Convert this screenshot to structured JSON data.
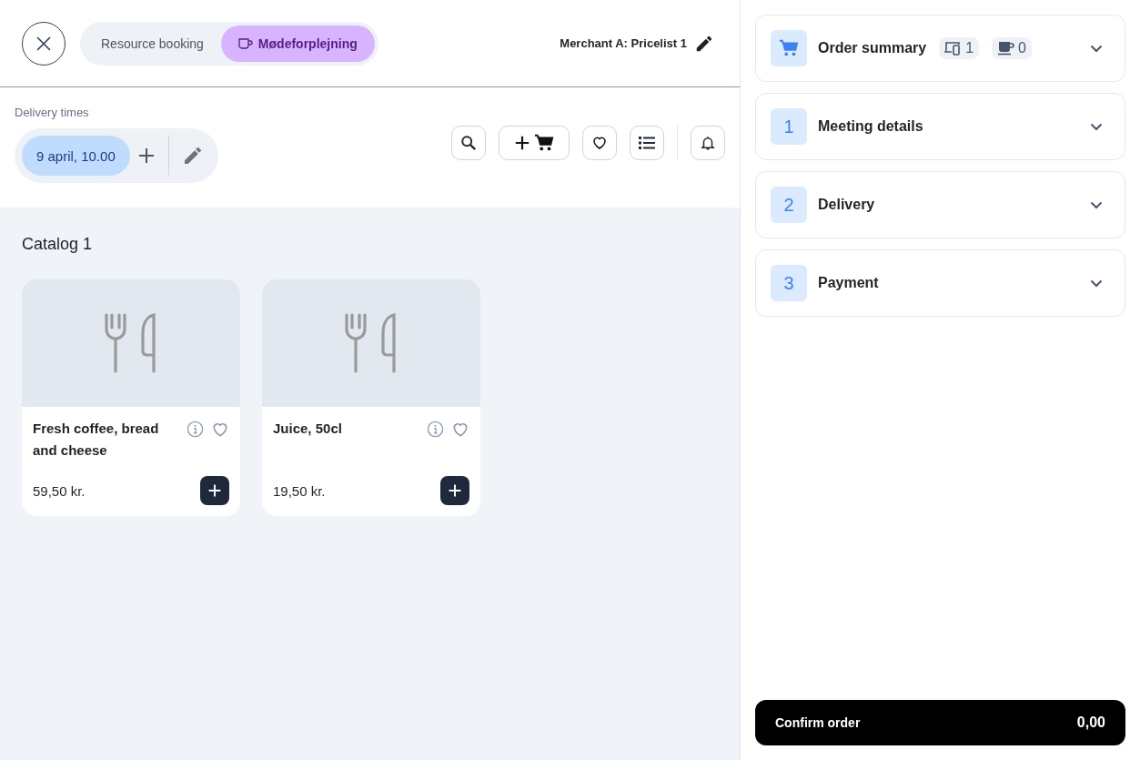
{
  "header": {
    "tabs": [
      {
        "label": "Resource booking",
        "kind": "resource",
        "selected": false
      },
      {
        "label": "Mødeforplejning",
        "kind": "catering",
        "selected": true
      }
    ],
    "pricelist": "Merchant A: Pricelist 1"
  },
  "delivery": {
    "label": "Delivery times",
    "times": [
      "9 april, 10.00"
    ]
  },
  "catalog": {
    "title": "Catalog 1",
    "products": [
      {
        "name": "Fresh coffee, bread and cheese",
        "price": "59,50 kr."
      },
      {
        "name": "Juice, 50cl",
        "price": "19,50 kr."
      }
    ]
  },
  "steps": [
    {
      "kind": "summary",
      "title": "Order summary",
      "badges": [
        {
          "kind": "devices",
          "count": "1"
        },
        {
          "kind": "catering",
          "count": "0"
        }
      ]
    },
    {
      "kind": "step",
      "number": "1",
      "title": "Meeting details"
    },
    {
      "kind": "step",
      "number": "2",
      "title": "Delivery"
    },
    {
      "kind": "step",
      "number": "3",
      "title": "Payment"
    }
  ],
  "confirm": {
    "label": "Confirm order",
    "total": "0,00"
  }
}
